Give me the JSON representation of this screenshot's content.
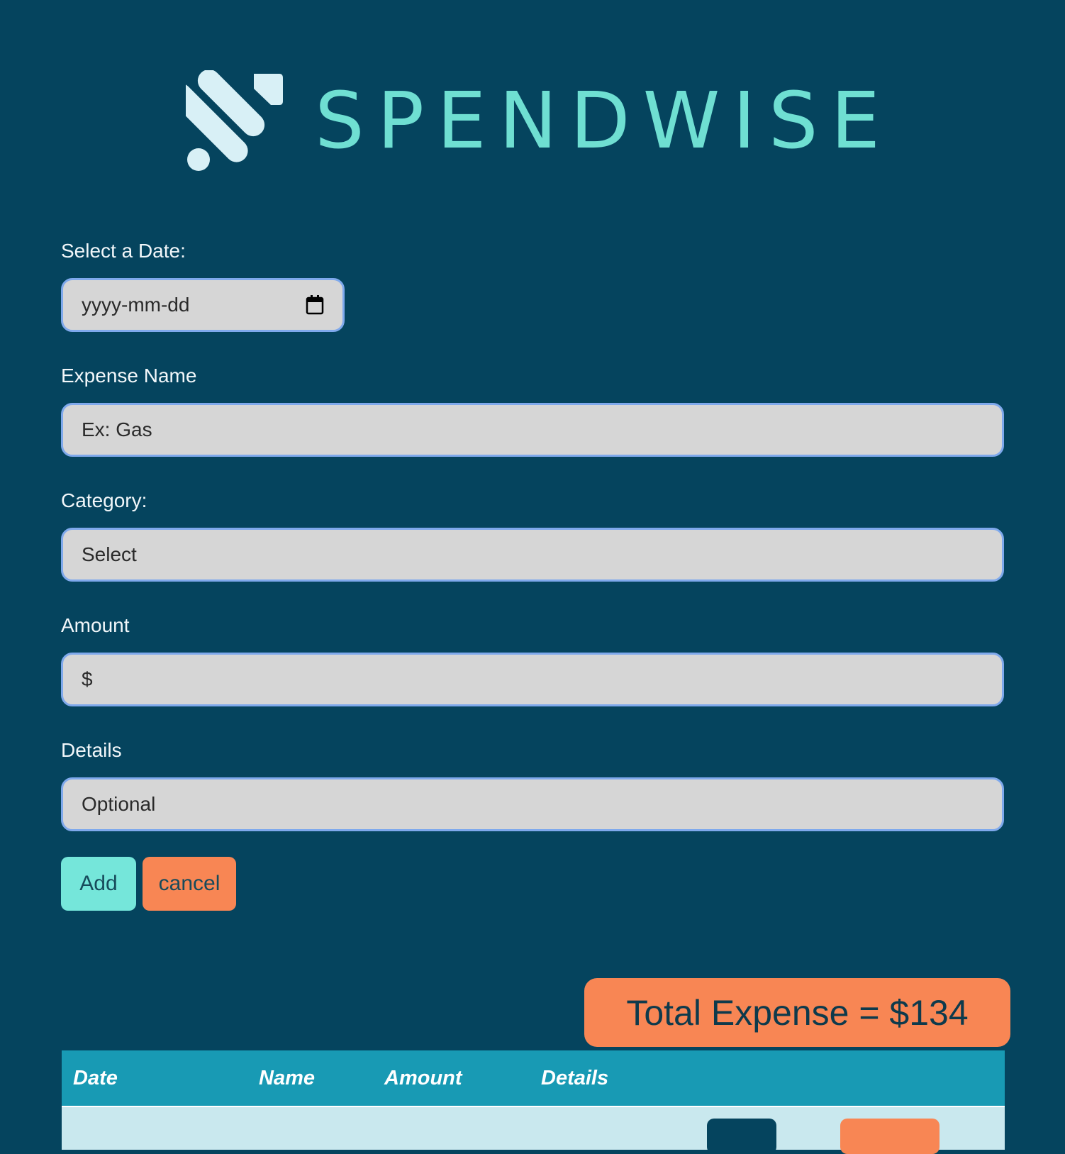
{
  "brand": {
    "name": "SPENDWISE",
    "colors": {
      "background": "#05445e",
      "accent": "#75e6da",
      "orange": "#f88654",
      "tableHeader": "#189ab4"
    }
  },
  "form": {
    "date_label": "Select a Date:",
    "date_placeholder": "yyyy-mm-dd",
    "name_label": "Expense Name",
    "name_placeholder": "Ex: Gas",
    "category_label": "Category:",
    "category_value": "Select",
    "amount_label": "Amount",
    "amount_placeholder": "$",
    "details_label": "Details",
    "details_placeholder": "Optional",
    "add_label": "Add",
    "cancel_label": "cancel"
  },
  "summary": {
    "total_label": "Total Expense = $134"
  },
  "table": {
    "columns": [
      "Date",
      "Name",
      "Amount",
      "Details"
    ],
    "rows": [
      {
        "date": "",
        "name": "",
        "amount": "",
        "details": ""
      }
    ]
  }
}
